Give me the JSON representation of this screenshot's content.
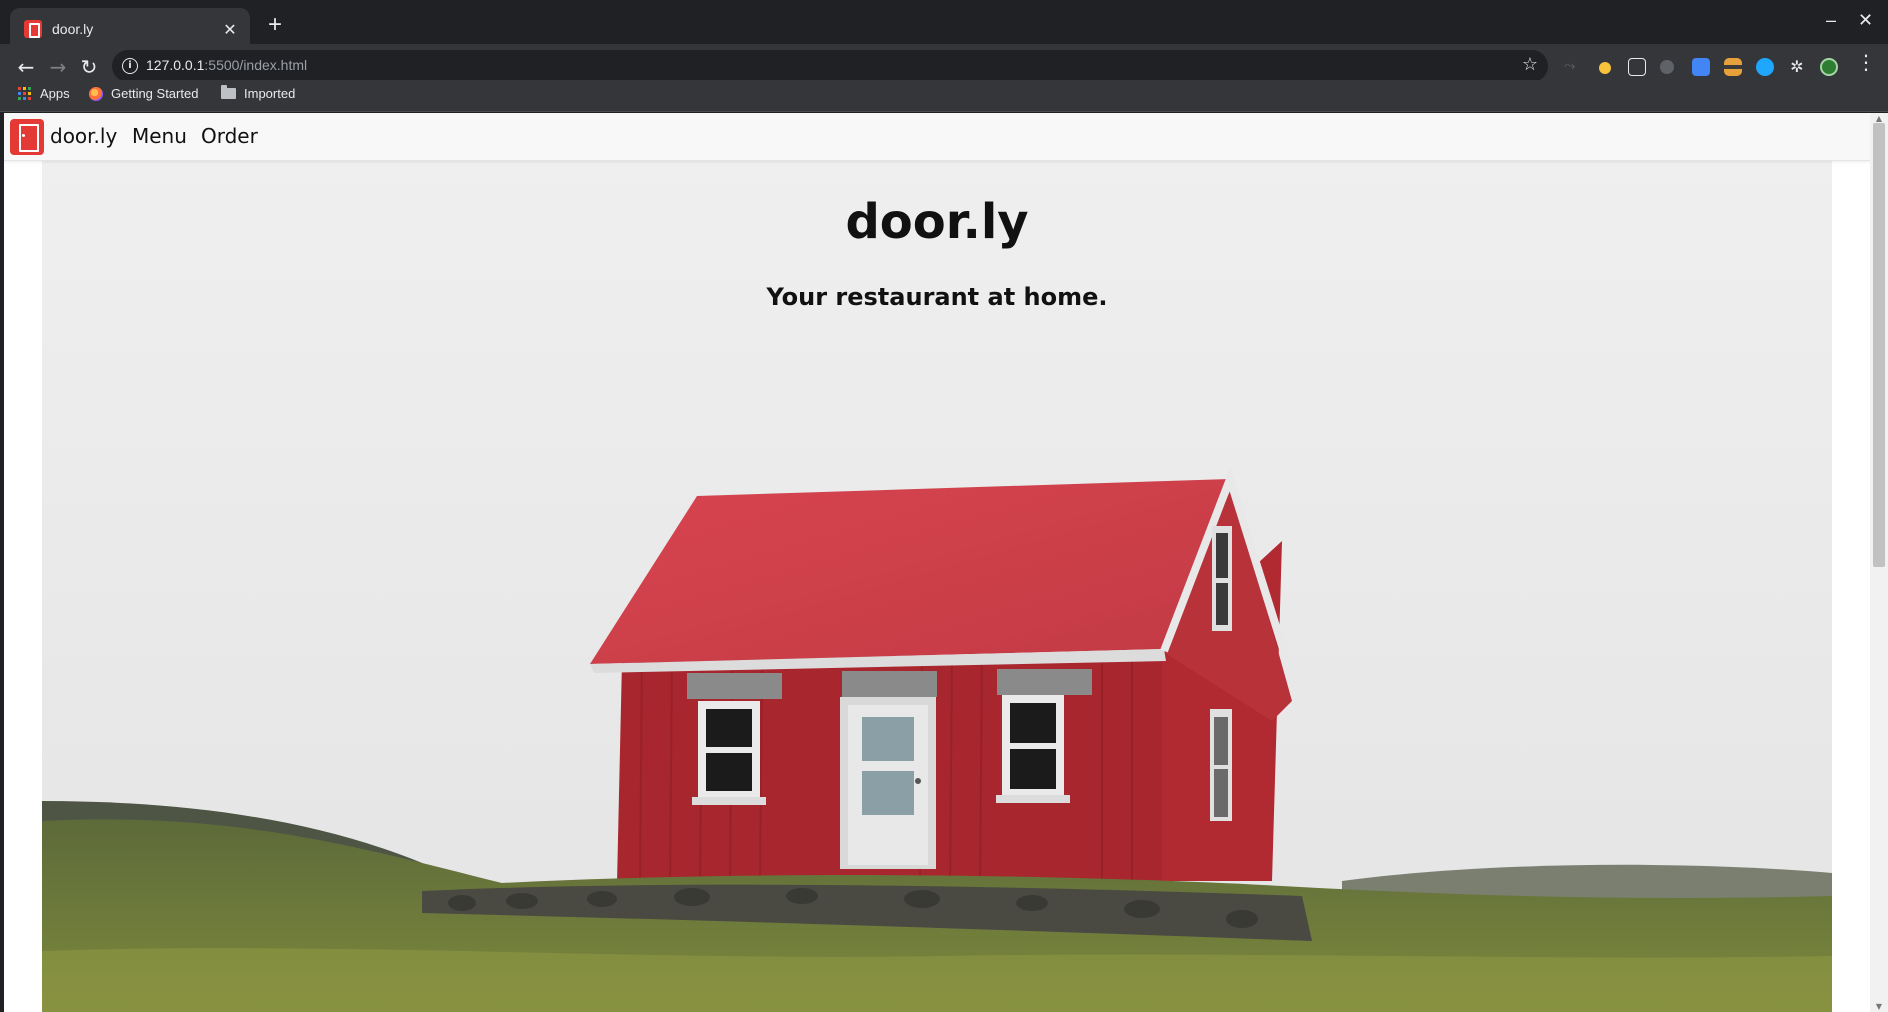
{
  "browser": {
    "tab": {
      "title": "door.ly"
    },
    "address": {
      "host": "127.0.0.1",
      "path": ":5500/index.html"
    },
    "bookmarks": [
      {
        "label": "Apps"
      },
      {
        "label": "Getting Started"
      },
      {
        "label": "Imported"
      }
    ],
    "window_controls": {
      "minimize": "–",
      "close": "✕"
    }
  },
  "site": {
    "brand": "door.ly",
    "nav": [
      {
        "label": "Menu"
      },
      {
        "label": "Order"
      }
    ],
    "hero": {
      "title": "door.ly",
      "subtitle": "Your restaurant at home."
    }
  },
  "colors": {
    "brand_red": "#e53935",
    "chrome_dark": "#202124",
    "chrome_mid": "#35363a"
  },
  "icons": [
    "back-arrow-icon",
    "forward-arrow-icon",
    "reload-icon",
    "info-icon",
    "star-icon",
    "apps-grid-icon",
    "firefox-icon",
    "folder-icon",
    "extensions-icon",
    "more-menu-icon"
  ]
}
